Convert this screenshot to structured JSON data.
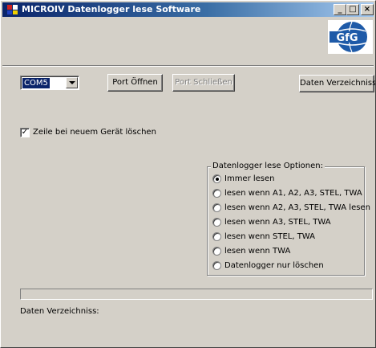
{
  "window": {
    "title": "MICROIV Datenlogger lese Software",
    "controls": {
      "minimize": "_",
      "maximize": "□",
      "close": "×"
    }
  },
  "logo": {
    "text": "GfG",
    "icon": "gfg-globe-logo",
    "colors": {
      "globe": "#1e5aa8",
      "text": "#ffffff"
    }
  },
  "port": {
    "selected": "COM5",
    "open_label": "Port Öffnen",
    "close_label": "Port Schließen",
    "close_enabled": false
  },
  "directory_button": "Daten Verzeichniss",
  "delete_row": {
    "checked": true,
    "label": "Zeile bei neuem Gerät löschen"
  },
  "options": {
    "legend": "Datenlogger lese Optionen:",
    "items": [
      {
        "label": "Immer lesen",
        "checked": true
      },
      {
        "label": "lesen wenn A1, A2, A3, STEL, TWA",
        "checked": false
      },
      {
        "label": "lesen wenn A2, A3, STEL, TWA lesen",
        "checked": false
      },
      {
        "label": "lesen wenn A3, STEL, TWA",
        "checked": false
      },
      {
        "label": "lesen wenn STEL, TWA",
        "checked": false
      },
      {
        "label": "lesen wenn TWA",
        "checked": false
      },
      {
        "label": "Datenlogger nur löschen",
        "checked": false
      }
    ]
  },
  "progress": {
    "value": 0
  },
  "status": {
    "directory_label": "Daten Verzeichniss:"
  },
  "colors": {
    "titlebar_active": "#0a246a",
    "face": "#d4d0c8",
    "selection": "#0a246a"
  }
}
